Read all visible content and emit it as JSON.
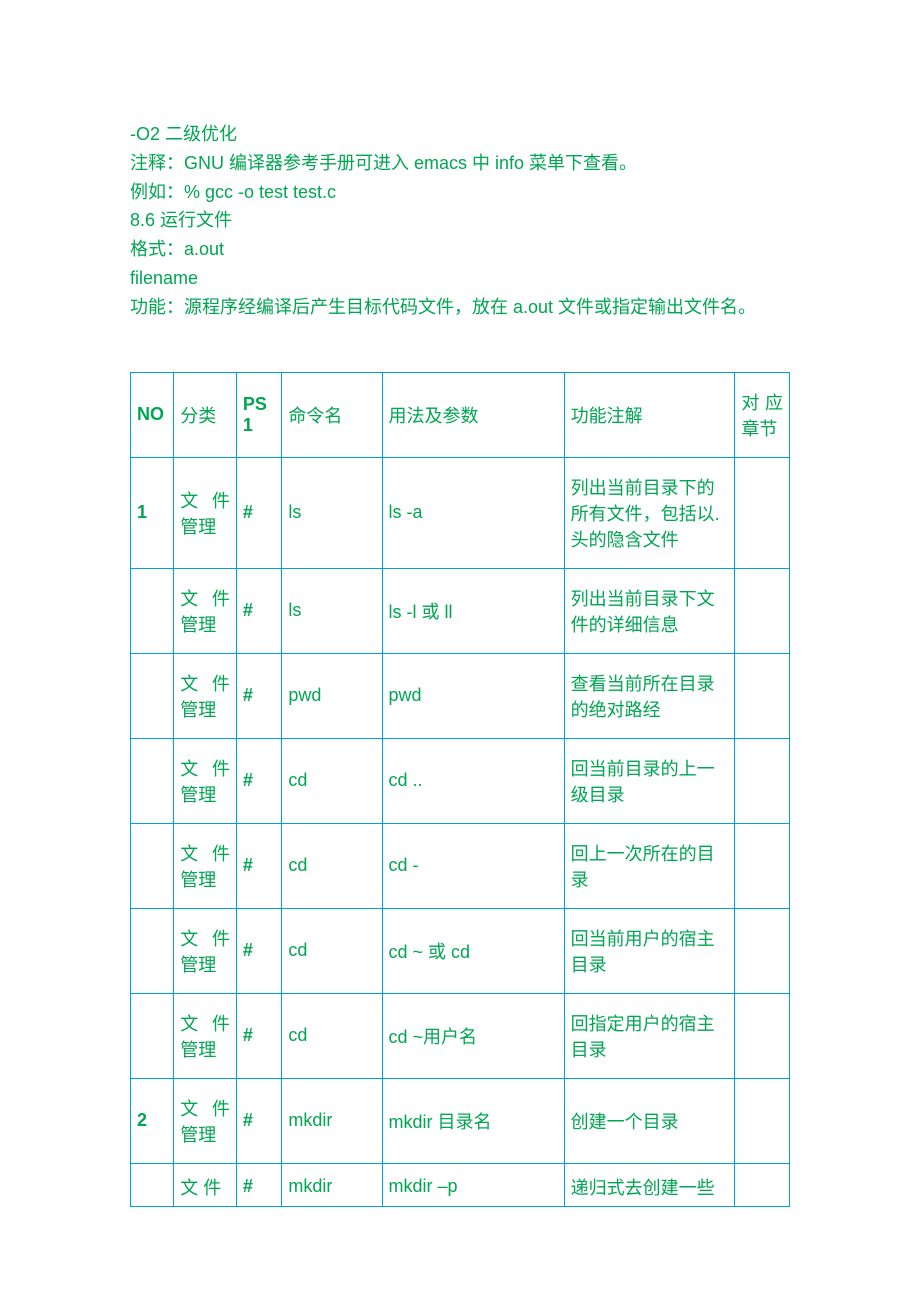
{
  "intro": {
    "line1": "-O2 二级优化",
    "line2": "注释：GNU 编译器参考手册可进入 emacs 中 info 菜单下查看。",
    "line3": "例如：% gcc -o test test.c",
    "line4": "8.6 运行文件",
    "line5": "格式：a.out",
    "line6": "filename",
    "line7": "功能：源程序经编译后产生目标代码文件，放在 a.out 文件或指定输出文件名。"
  },
  "headers": {
    "no": "NO",
    "cat": "分类",
    "ps1": "PS1",
    "cmd": "命令名",
    "usage": "用法及参数",
    "desc": "功能注解",
    "chap": "对 应章节"
  },
  "rows": [
    {
      "no": "1",
      "cat": "文 件管理",
      "ps1": "#",
      "cmd": "ls",
      "usage": "ls -a",
      "desc": "列出当前目录下的所有文件，包括以. 头的隐含文件",
      "chap": ""
    },
    {
      "no": "",
      "cat": "文 件管理",
      "ps1": "#",
      "cmd": "ls",
      "usage": "ls -l 或 ll",
      "desc": "列出当前目录下文件的详细信息",
      "chap": ""
    },
    {
      "no": "",
      "cat": "文 件管理",
      "ps1": "#",
      "cmd": "pwd",
      "usage": "pwd",
      "desc": "查看当前所在目录的绝对路经",
      "chap": ""
    },
    {
      "no": "",
      "cat": "文 件管理",
      "ps1": "#",
      "cmd": "cd",
      "usage": "cd ..",
      "desc": "回当前目录的上一级目录",
      "chap": ""
    },
    {
      "no": "",
      "cat": "文 件管理",
      "ps1": "#",
      "cmd": "cd",
      "usage": "cd -",
      "desc": "回上一次所在的目录",
      "chap": ""
    },
    {
      "no": "",
      "cat": "文 件管理",
      "ps1": "#",
      "cmd": "cd",
      "usage": "cd ~ 或 cd",
      "desc": "回当前用户的宿主目录",
      "chap": ""
    },
    {
      "no": "",
      "cat": "文 件管理",
      "ps1": "#",
      "cmd": "cd",
      "usage": "cd ~用户名",
      "desc": "回指定用户的宿主目录",
      "chap": ""
    },
    {
      "no": "2",
      "cat": "文 件管理",
      "ps1": "#",
      "cmd": "mkdir",
      "usage": "mkdir 目录名",
      "desc": "创建一个目录",
      "chap": ""
    },
    {
      "no": "",
      "cat": "文 件",
      "ps1": "#",
      "cmd": "mkdir",
      "usage": "mkdir –p",
      "desc": "递归式去创建一些",
      "chap": ""
    }
  ]
}
